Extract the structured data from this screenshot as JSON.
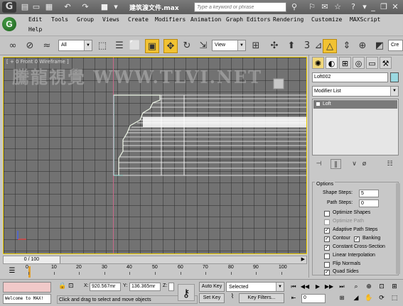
{
  "window": {
    "title": "建筑渡文件.max",
    "search_placeholder": "Type a keyword or phrase",
    "app_logo": "G"
  },
  "quick_access": [
    "folder-open-icon",
    "save-icon",
    "undo-icon",
    "redo-icon",
    "project-folder-icon",
    "dropdown-icon"
  ],
  "menubar": {
    "items": [
      "Edit",
      "Tools",
      "Group",
      "Views",
      "Create",
      "Modifiers",
      "Animation",
      "Graph Editors",
      "Rendering",
      "Customize",
      "MAXScript",
      "Help"
    ]
  },
  "toolbar": {
    "selection_filter": "All",
    "reference_coord": "View",
    "snap_label": "3",
    "named_selection_placeholder": "Cre"
  },
  "viewport": {
    "label": "[ + 0 Front 0 Wireframe ]",
    "watermark": "騰龍視覺 WWW.TLVI.NET"
  },
  "command_panel": {
    "object_name": "Loft002",
    "object_color": "#9ad8e0",
    "modifier_list": "Modifier List",
    "stack_item": "Loft",
    "options": {
      "title": "Options",
      "shape_steps_label": "Shape Steps:",
      "shape_steps_value": "5",
      "path_steps_label": "Path Steps:",
      "path_steps_value": "0",
      "optimize_shapes": "Optimize Shapes",
      "optimize_path": "Optimize Path",
      "adaptive_path_steps": "Adaptive Path Steps",
      "contour": "Contour",
      "banking": "Banking",
      "constant_cross_section": "Constant Cross-Section",
      "linear_interpolation": "Linear Interpolation",
      "flip_normals": "Flip Normals",
      "quad_sides": "Quad Sides"
    }
  },
  "timeline": {
    "slider_label": "0 / 100",
    "ticks": [
      "0",
      "10",
      "20",
      "30",
      "40",
      "50",
      "60",
      "70",
      "80",
      "90",
      "100"
    ]
  },
  "status": {
    "listener_text": "Welcome to MAX!",
    "x_label": "X:",
    "x_value": "920.567mr",
    "y_label": "Y:",
    "y_value": "136.365mr",
    "z_label": "Z:",
    "prompt": "Click and drag to select and move objects",
    "auto_key": "Auto Key",
    "set_key": "Set Key",
    "key_mode": "Selected",
    "key_filters": "Key Filters...",
    "frame": "0"
  }
}
